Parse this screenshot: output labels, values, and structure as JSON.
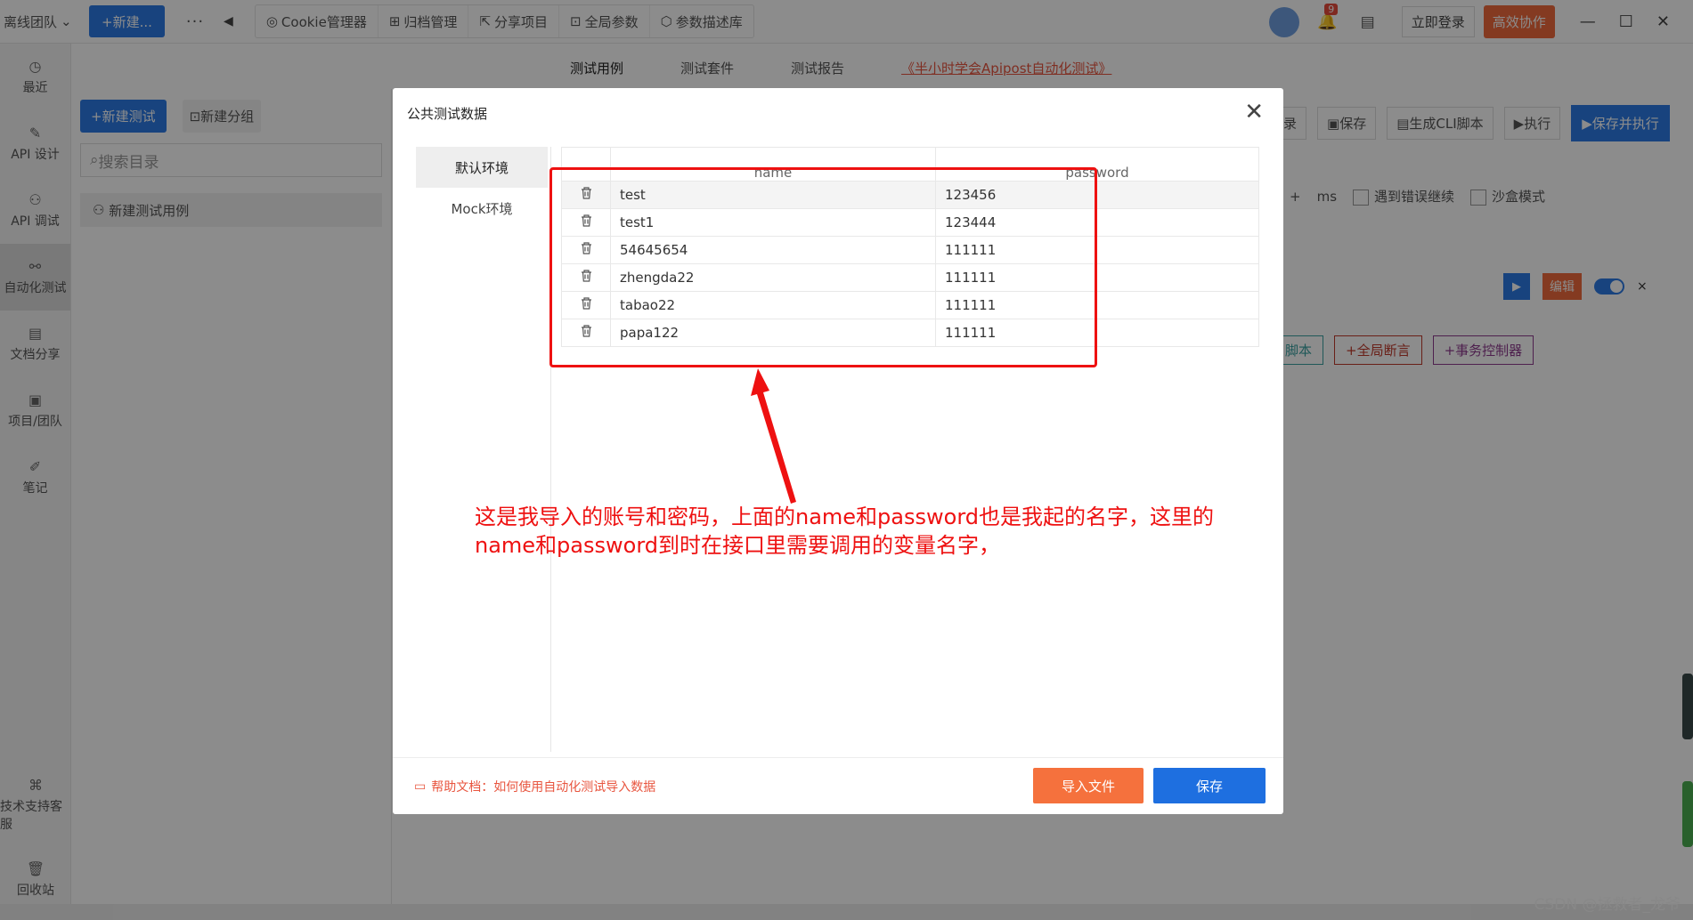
{
  "topbar": {
    "team": "离线团队",
    "new_button": "+新建...",
    "more": "···",
    "tools": [
      "Cookie管理器",
      "归档管理",
      "分享项目",
      "全局参数",
      "参数描述库"
    ],
    "notification_count": "9",
    "login": "立即登录",
    "collab": "高效协作"
  },
  "sidebar": {
    "items": [
      "最近",
      "API 设计",
      "API 调试",
      "自动化测试",
      "文档分享",
      "项目/团队",
      "笔记"
    ],
    "support": "技术支持客服",
    "recycle": "回收站"
  },
  "subtabs": [
    "测试用例",
    "测试套件",
    "测试报告",
    "《半小时学会Apipost自动化测试》"
  ],
  "left_panel": {
    "new_test": "+新建测试",
    "new_group": "新建分组",
    "search_placeholder": "搜索目录",
    "case_name": "新建测试用例"
  },
  "right_toolbar": {
    "record": "录",
    "save": "保存",
    "gen_cli": "生成CLI脚本",
    "execute": "执行",
    "save_execute": "保存并执行"
  },
  "options": {
    "plus": "+",
    "unit": "ms",
    "continue_on_error": "遇到错误继续",
    "sandbox": "沙盒模式"
  },
  "step": {
    "edit": "编辑",
    "close": "×"
  },
  "add_buttons": {
    "script": "脚本",
    "global_assert": "+全局断言",
    "transaction": "+事务控制器"
  },
  "modal": {
    "title": "公共测试数据",
    "env_tabs": [
      "默认环境",
      "Mock环境"
    ],
    "columns": [
      "name",
      "password"
    ],
    "rows": [
      {
        "name": "test",
        "password": "123456"
      },
      {
        "name": "test1",
        "password": "123444"
      },
      {
        "name": "54645654",
        "password": "111111"
      },
      {
        "name": "zhengda22",
        "password": "111111"
      },
      {
        "name": "tabao22",
        "password": "111111"
      },
      {
        "name": "papa122",
        "password": "111111"
      }
    ],
    "help_text": "帮助文档：如何使用自动化测试导入数据",
    "import_button": "导入文件",
    "save_button": "保存"
  },
  "annotation": "这是我导入的账号和密码，上面的name和password也是我起的名字，这里的name和password到时在接口里需要调用的变量名字，",
  "watermark": "CSDN @拯救者_龙爷",
  "colors": {
    "primary": "#2c7be5",
    "accent": "#f5713d",
    "annotation": "#ee1111"
  }
}
